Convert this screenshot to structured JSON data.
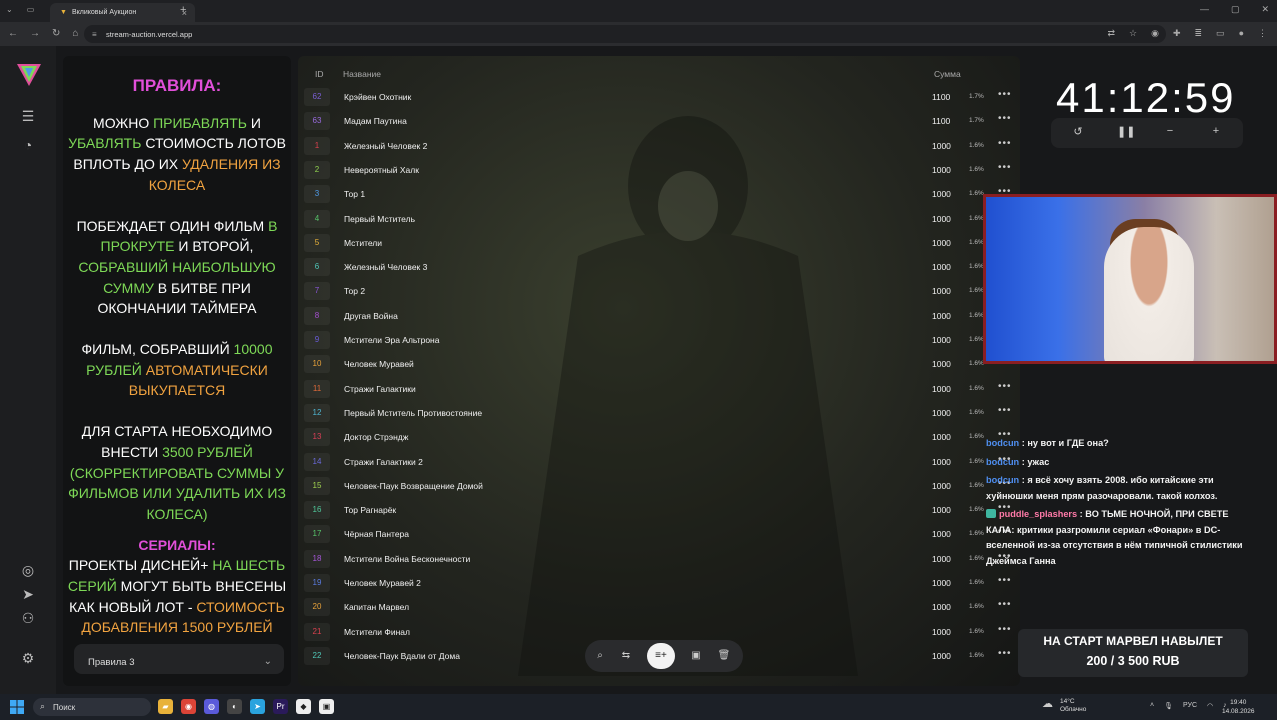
{
  "browser": {
    "tab_title": "Вкликовый Аукцион",
    "tab_close": "×",
    "new_tab": "+",
    "url": "stream-auction.vercel.app"
  },
  "rules": {
    "title": "ПРАВИЛА:",
    "p1": [
      {
        "t": "МОЖНО ",
        "c": "w"
      },
      {
        "t": "ПРИБАВЛЯТЬ",
        "c": "g"
      },
      {
        "t": " И ",
        "c": "w"
      },
      {
        "t": "УБАВЛЯТЬ",
        "c": "g"
      },
      {
        "t": " СТОИМОСТЬ ЛОТОВ ВПЛОТЬ ДО ИХ ",
        "c": "w"
      },
      {
        "t": "УДАЛЕНИЯ ИЗ КОЛЕСА",
        "c": "o"
      }
    ],
    "p2": [
      {
        "t": "ПОБЕЖДАЕТ ОДИН ФИЛЬМ ",
        "c": "w"
      },
      {
        "t": "В ПРОКРУТЕ",
        "c": "g"
      },
      {
        "t": " И ВТОРОЙ, ",
        "c": "w"
      },
      {
        "t": "СОБРАВШИЙ НАИБОЛЬШУЮ СУММУ",
        "c": "g"
      },
      {
        "t": " В БИТВЕ ПРИ ОКОНЧАНИИ ТАЙМЕРА",
        "c": "w"
      }
    ],
    "p3": [
      {
        "t": "ФИЛЬМ, СОБРАВШИЙ ",
        "c": "w"
      },
      {
        "t": "10000 РУБЛЕЙ",
        "c": "g"
      },
      {
        "t": " АВТОМАТИЧЕСКИ ВЫКУПАЕТСЯ",
        "c": "o"
      }
    ],
    "p4": [
      {
        "t": "ДЛЯ СТАРТА НЕОБХОДИМО ВНЕСТИ ",
        "c": "w"
      },
      {
        "t": "3500 РУБЛЕЙ (СКОРРЕКТИРОВАТЬ СУММЫ У ФИЛЬМОВ ИЛИ УДАЛИТЬ ИХ ИЗ КОЛЕСА)",
        "c": "g"
      }
    ],
    "serials_title": "СЕРИАЛЫ:",
    "p5": [
      {
        "t": "ПРОЕКТЫ ДИСНЕЙ+ ",
        "c": "w"
      },
      {
        "t": "НА ШЕСТЬ СЕРИЙ",
        "c": "g"
      },
      {
        "t": " МОГУТ БЫТЬ ВНЕСЕНЫ КАК НОВЫЙ ЛОТ - ",
        "c": "w"
      },
      {
        "t": "СТОИМОСТЬ ДОБАВЛЕНИЯ 1500 РУБЛЕЙ",
        "c": "o"
      }
    ],
    "select_value": "Правила 3"
  },
  "lots": {
    "col_id": "ID",
    "col_name": "Название",
    "col_sum": "Сумма",
    "rows": [
      {
        "id": "62",
        "name": "Крэйвен Охотник",
        "sum": "1100",
        "pct": "1.7%",
        "color": "#7b5fd6"
      },
      {
        "id": "63",
        "name": "Мадам Паутина",
        "sum": "1100",
        "pct": "1.7%",
        "color": "#9a6be0"
      },
      {
        "id": "1",
        "name": "Железный Человек 2",
        "sum": "1000",
        "pct": "1.6%",
        "color": "#d9414e"
      },
      {
        "id": "2",
        "name": "Невероятный Халк",
        "sum": "1000",
        "pct": "1.6%",
        "color": "#8fd14f"
      },
      {
        "id": "3",
        "name": "Тор 1",
        "sum": "1000",
        "pct": "1.6%",
        "color": "#4f9be8"
      },
      {
        "id": "4",
        "name": "Первый Мститель",
        "sum": "1000",
        "pct": "1.6%",
        "color": "#57c46a"
      },
      {
        "id": "5",
        "name": "Мстители",
        "sum": "1000",
        "pct": "1.6%",
        "color": "#e8b23a"
      },
      {
        "id": "6",
        "name": "Железный Человек 3",
        "sum": "1000",
        "pct": "1.6%",
        "color": "#4fc7b8"
      },
      {
        "id": "7",
        "name": "Тор 2",
        "sum": "1000",
        "pct": "1.6%",
        "color": "#8a56d8"
      },
      {
        "id": "8",
        "name": "Другая Война",
        "sum": "1000",
        "pct": "1.6%",
        "color": "#a64fd1"
      },
      {
        "id": "9",
        "name": "Мстители Эра Альтрона",
        "sum": "1000",
        "pct": "1.6%",
        "color": "#6a5cd9"
      },
      {
        "id": "10",
        "name": "Человек Муравей",
        "sum": "1000",
        "pct": "1.6%",
        "color": "#e8a23a"
      },
      {
        "id": "11",
        "name": "Стражи Галактики",
        "sum": "1000",
        "pct": "1.6%",
        "color": "#e06a3a"
      },
      {
        "id": "12",
        "name": "Первый Мститель Противостояние",
        "sum": "1000",
        "pct": "1.6%",
        "color": "#4fb5d1"
      },
      {
        "id": "13",
        "name": "Доктор Стрэндж",
        "sum": "1000",
        "pct": "1.6%",
        "color": "#d93f57"
      },
      {
        "id": "14",
        "name": "Стражи Галактики 2",
        "sum": "1000",
        "pct": "1.6%",
        "color": "#6a6ad9"
      },
      {
        "id": "15",
        "name": "Человек-Паук Возвращение Домой",
        "sum": "1000",
        "pct": "1.6%",
        "color": "#9fd14f"
      },
      {
        "id": "16",
        "name": "Тор Рагнарёк",
        "sum": "1000",
        "pct": "1.6%",
        "color": "#4fc79a"
      },
      {
        "id": "17",
        "name": "Чёрная Пантера",
        "sum": "1000",
        "pct": "1.6%",
        "color": "#57c46a"
      },
      {
        "id": "18",
        "name": "Мстители Война Бесконечности",
        "sum": "1000",
        "pct": "1.6%",
        "color": "#a656d8"
      },
      {
        "id": "19",
        "name": "Человек Муравей 2",
        "sum": "1000",
        "pct": "1.6%",
        "color": "#5a7be0"
      },
      {
        "id": "20",
        "name": "Капитан Марвел",
        "sum": "1000",
        "pct": "1.6%",
        "color": "#e8a23a"
      },
      {
        "id": "21",
        "name": "Мстители Финал",
        "sum": "1000",
        "pct": "1.6%",
        "color": "#d9414e"
      },
      {
        "id": "22",
        "name": "Человек-Паук Вдали от Дома",
        "sum": "1000",
        "pct": "1.6%",
        "color": "#4fc7b8"
      }
    ],
    "dots": "•••"
  },
  "timer": {
    "value": "41:12:59"
  },
  "chat": [
    {
      "user": "bodcun",
      "text": " : ну вот и ГДЕ она?",
      "uc": "u1",
      "badge": false
    },
    {
      "user": "bodcun",
      "text": " : ужас",
      "uc": "u1",
      "badge": false
    },
    {
      "user": "bodcun",
      "text": " : я всё хочу взять 2008. ибо китайские эти хуйнюшки меня прям разочаровали. такой колхоз.",
      "uc": "u1",
      "badge": false
    },
    {
      "user": "puddle_splashers",
      "text": " : ВО ТЬМЕ НОЧНОЙ, ПРИ СВЕТЕ КАЛА: критики разгромили сериал «Фонари» в DC-вселенной из-за отсутствия в нём типичной стилистики Джеймса Ганна",
      "uc": "u2",
      "badge": true
    }
  ],
  "goal": {
    "line1": "НА СТАРТ МАРВЕЛ НАВЫЛЕТ",
    "line2": "200 / 3 500 RUB"
  },
  "taskbar": {
    "search": "Поиск",
    "weather_temp": "14°C",
    "weather_desc": "Облачно",
    "lang": "РУС",
    "time": "19:40",
    "date": "14.08.2026"
  }
}
